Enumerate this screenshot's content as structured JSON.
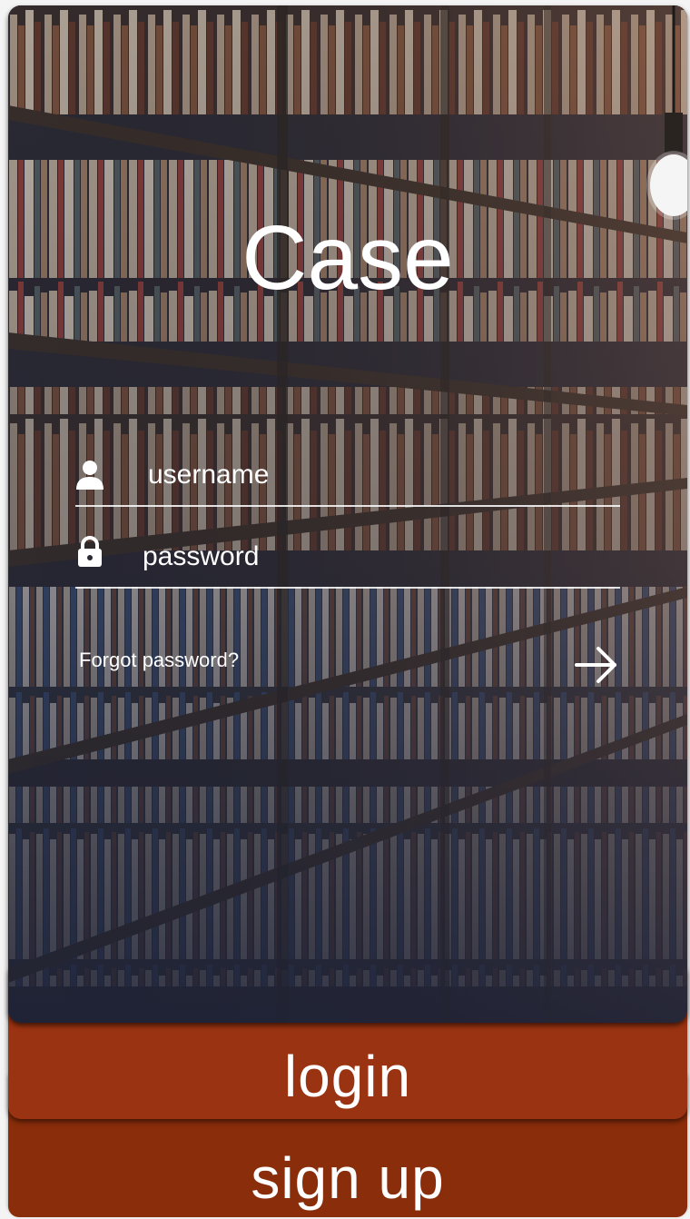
{
  "app": {
    "title": "Case"
  },
  "login_form": {
    "username_placeholder": "username",
    "password_placeholder": "password",
    "forgot_password_label": "Forgot password?"
  },
  "buttons": {
    "login_label": "login",
    "signup_label": "sign up"
  },
  "icons": {
    "username": "person-icon",
    "password": "lock-icon",
    "submit": "arrow-right-icon"
  },
  "colors": {
    "login_button": "#9a3311",
    "signup_button": "#8a2d0a",
    "text": "#ffffff"
  }
}
